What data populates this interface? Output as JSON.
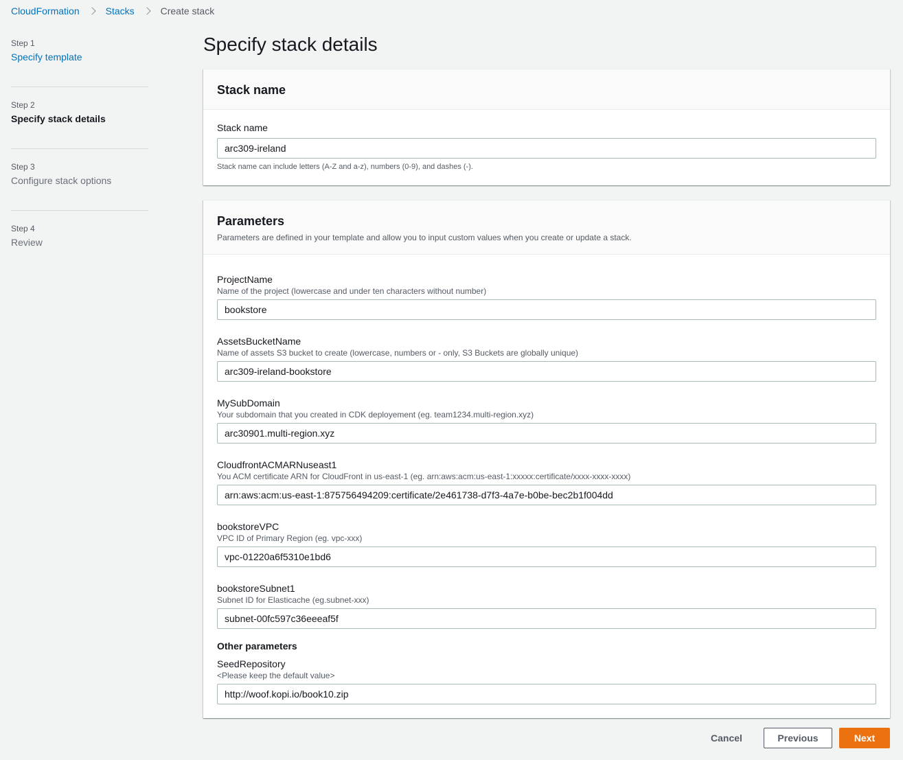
{
  "breadcrumb": {
    "items": [
      "CloudFormation",
      "Stacks"
    ],
    "current": "Create stack"
  },
  "steps": [
    {
      "num": "Step 1",
      "title": "Specify template",
      "state": "link"
    },
    {
      "num": "Step 2",
      "title": "Specify stack details",
      "state": "active"
    },
    {
      "num": "Step 3",
      "title": "Configure stack options",
      "state": "disabled"
    },
    {
      "num": "Step 4",
      "title": "Review",
      "state": "disabled"
    }
  ],
  "page_title": "Specify stack details",
  "stack_name_panel": {
    "heading": "Stack name",
    "label": "Stack name",
    "value": "arc309-ireland",
    "hint": "Stack name can include letters (A-Z and a-z), numbers (0-9), and dashes (-)."
  },
  "parameters_panel": {
    "heading": "Parameters",
    "description": "Parameters are defined in your template and allow you to input custom values when you create or update a stack.",
    "params": [
      {
        "label": "ProjectName",
        "description": "Name of the project (lowercase and under ten characters without number)",
        "value": "bookstore"
      },
      {
        "label": "AssetsBucketName",
        "description": "Name of assets S3 bucket to create (lowercase, numbers or - only, S3 Buckets are globally unique)",
        "value": "arc309-ireland-bookstore"
      },
      {
        "label": "MySubDomain",
        "description": "Your subdomain that you created in CDK deployement (eg. team1234.multi-region.xyz)",
        "value": "arc30901.multi-region.xyz"
      },
      {
        "label": "CloudfrontACMARNuseast1",
        "description": "You ACM certificate ARN for CloudFront in us-east-1 (eg. arn:aws:acm:us-east-1:xxxxx:certificate/xxxx-xxxx-xxxx)",
        "value": "arn:aws:acm:us-east-1:875756494209:certificate/2e461738-d7f3-4a7e-b0be-bec2b1f004dd"
      },
      {
        "label": "bookstoreVPC",
        "description": "VPC ID of Primary Region (eg. vpc-xxx)",
        "value": "vpc-01220a6f5310e1bd6"
      },
      {
        "label": "bookstoreSubnet1",
        "description": "Subnet ID for Elasticache (eg.subnet-xxx)",
        "value": "subnet-00fc597c36eeeaf5f"
      }
    ],
    "other_heading": "Other parameters",
    "other_params": [
      {
        "label": "SeedRepository",
        "description": "<Please keep the default value>",
        "value": "http://woof.kopi.io/book10.zip"
      }
    ]
  },
  "footer": {
    "cancel_label": "Cancel",
    "previous_label": "Previous",
    "next_label": "Next"
  },
  "colors": {
    "link": "#0073bb",
    "primary_button": "#ec7211",
    "background": "#f2f3f3"
  }
}
